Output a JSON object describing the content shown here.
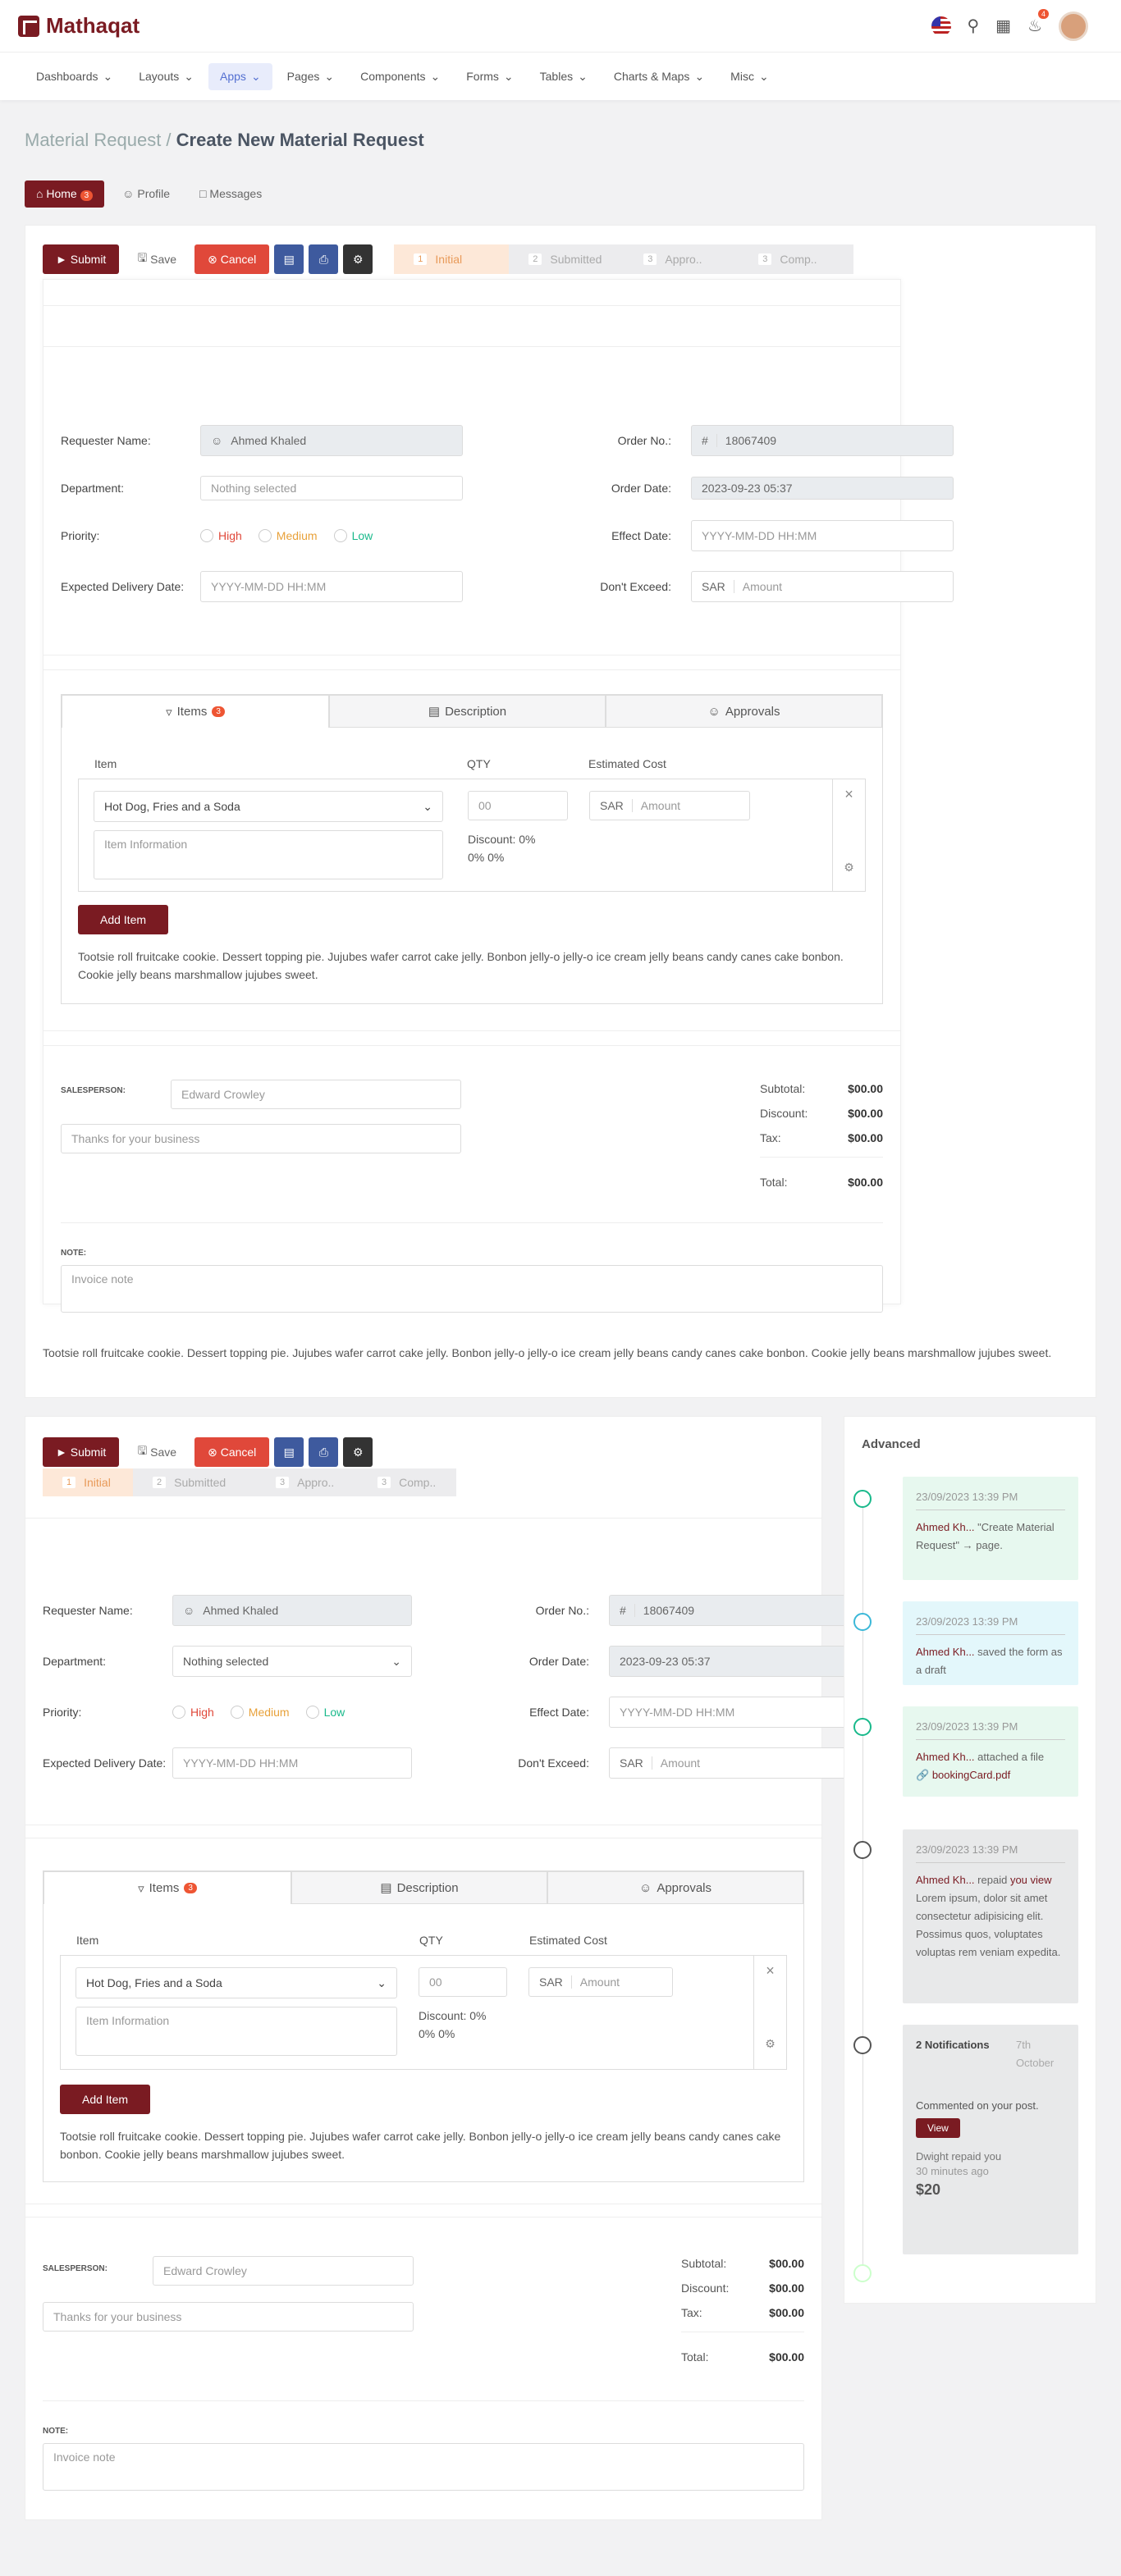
{
  "app": {
    "name": "Mathaqat",
    "notif_count": "4"
  },
  "nav": [
    "Dashboards",
    "Layouts",
    "Apps",
    "Pages",
    "Components",
    "Forms",
    "Tables",
    "Charts & Maps",
    "Misc"
  ],
  "breadcrumb": {
    "parent": "Material Request /",
    "current": "Create New Material Request"
  },
  "profile_tabs": {
    "home": "Home",
    "home_badge": "3",
    "profile": "Profile",
    "messages": "Messages"
  },
  "toolbar": {
    "submit": "Submit",
    "save": "Save",
    "cancel": "Cancel"
  },
  "steps": [
    {
      "n": "1",
      "label": "Initial"
    },
    {
      "n": "2",
      "label": "Submitted"
    },
    {
      "n": "3",
      "label": "Appro.."
    },
    {
      "n": "3",
      "label": "Comp.."
    }
  ],
  "form": {
    "requester_label": "Requester Name:",
    "requester": "Ahmed Khaled",
    "order_no_label": "Order No.:",
    "order_no": "18067409",
    "department_label": "Department:",
    "department": "Nothing selected",
    "order_date_label": "Order Date:",
    "order_date": "2023-09-23 05:37",
    "priority_label": "Priority:",
    "high": "High",
    "medium": "Medium",
    "low": "Low",
    "effect_label": "Effect Date:",
    "date_placeholder": "YYYY-MM-DD HH:MM",
    "expected_label": "Expected Delivery Date:",
    "exceed_label": "Don't Exceed:",
    "currency": "SAR",
    "amount": "Amount",
    "hash": "#"
  },
  "items_tabs": {
    "items": "Items",
    "items_badge": "3",
    "description": "Description",
    "approvals": "Approvals"
  },
  "items": {
    "item_h": "Item",
    "qty_h": "QTY",
    "cost_h": "Estimated Cost",
    "item": "Hot Dog, Fries and a Soda",
    "info": "Item Information",
    "qty": "00",
    "discount": "Discount: 0%",
    "pct": "0%   0%",
    "add": "Add Item"
  },
  "lorem": "Tootsie roll fruitcake cookie. Dessert topping pie. Jujubes wafer carrot cake jelly. Bonbon jelly-o jelly-o ice cream jelly beans candy canes cake bonbon. Cookie jelly beans marshmallow jujubes sweet.",
  "invoice": {
    "salesperson_label": "SALESPERSON:",
    "salesperson": "Edward Crowley",
    "thanks": "Thanks for your business",
    "subtotal": "Subtotal:",
    "discount": "Discount:",
    "tax": "Tax:",
    "total": "Total:",
    "zero": "$00.00",
    "note_label": "NOTE:",
    "note": "Invoice note"
  },
  "timeline": {
    "title": "Advanced",
    "time": "23/09/2023 13:39 PM",
    "user": "Ahmed Kh...",
    "e1a": "\"Create Material Request\"",
    "e1b": "page.",
    "e2": "saved the form as a draft",
    "e3": "attached a file",
    "file": "bookingCard.pdf",
    "e4a": "repaid",
    "e4b": "you view",
    "e4c": "Lorem ipsum, dolor sit amet consectetur adipisicing elit. Possimus quos, voluptates voluptas rem veniam expedita.",
    "n_title": "2 Notifications",
    "n_date": "7th October",
    "n_text": "Commented on your post.",
    "view": "View",
    "dwight": "Dwight repaid you",
    "ago": "30 minutes ago",
    "amount": "$20"
  }
}
